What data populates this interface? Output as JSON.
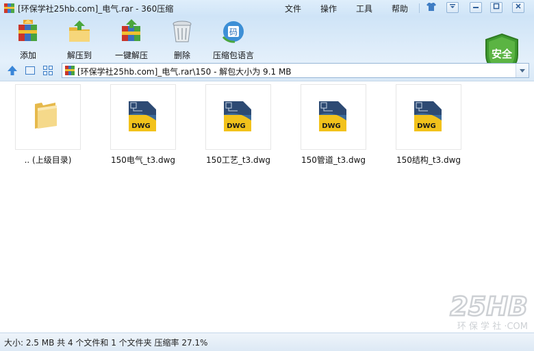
{
  "window": {
    "title": "[环保学社25hb.com]_电气.rar - 360压缩",
    "menu": [
      "文件",
      "操作",
      "工具",
      "帮助"
    ],
    "controls": [
      "skin",
      "menu",
      "minimize",
      "maximize",
      "close"
    ]
  },
  "toolbar": {
    "items": [
      {
        "label": "添加",
        "icon": "add-archive-icon"
      },
      {
        "label": "解压到",
        "icon": "extract-to-icon"
      },
      {
        "label": "一键解压",
        "icon": "one-click-extract-icon"
      },
      {
        "label": "删除",
        "icon": "delete-icon"
      },
      {
        "label": "压缩包语言",
        "icon": "archive-language-icon"
      }
    ],
    "security_label": "安全"
  },
  "address": {
    "path": "[环保学社25hb.com]_电气.rar\\150 - 解包大小为 9.1 MB"
  },
  "files": [
    {
      "name": ".. (上级目录)",
      "type": "folder"
    },
    {
      "name": "150电气_t3.dwg",
      "type": "dwg"
    },
    {
      "name": "150工艺_t3.dwg",
      "type": "dwg"
    },
    {
      "name": "150管道_t3.dwg",
      "type": "dwg"
    },
    {
      "name": "150结构_t3.dwg",
      "type": "dwg"
    }
  ],
  "file_type_label": "DWG",
  "status": {
    "text": "大小: 2.5 MB 共 4 个文件和 1 个文件夹 压缩率 27.1%"
  },
  "watermark": {
    "logo": "25HB",
    "tagline": "环 保 学 社 ·COM"
  },
  "colors": {
    "frame": "#d8e8f6",
    "shield": "#3f9a2f",
    "dwg_yellow": "#f2c21b",
    "dwg_blue": "#2d4a73"
  }
}
